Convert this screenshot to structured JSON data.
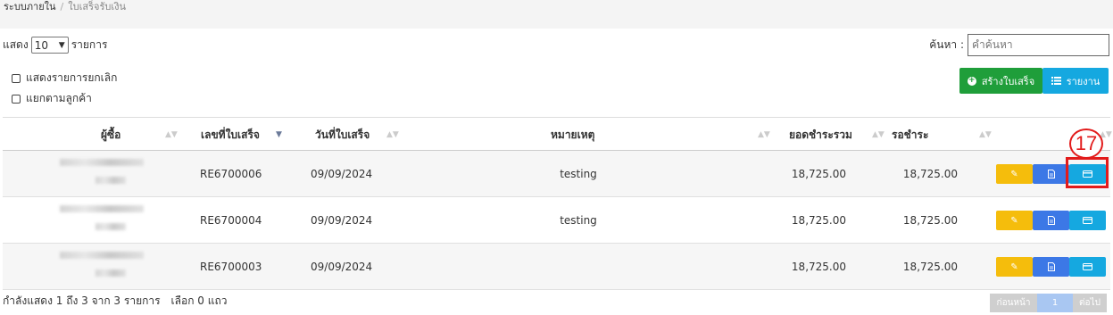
{
  "breadcrumb": {
    "root": "ระบบภายใน",
    "separator": "/",
    "current": "ใบเสร็จรับเงิน"
  },
  "length": {
    "prefix": "แสดง",
    "value": "10",
    "suffix": "รายการ"
  },
  "search": {
    "label": "ค้นหา :",
    "placeholder": "คำค้นหา"
  },
  "options": {
    "show_cancelled": "แสดงรายการยกเลิก",
    "group_by_customer": "แยกตามลูกค้า"
  },
  "toolbar": {
    "create_label": "สร้างใบเสร็จ",
    "report_label": "รายงาน"
  },
  "table": {
    "headers": {
      "buyer": "ผู้ซื้อ",
      "receipt_no": "เลขที่ใบเสร็จ",
      "date": "วันที่ใบเสร็จ",
      "note": "หมายเหตุ",
      "total": "ยอดชำระรวม",
      "pending": "รอชำระ"
    },
    "rows": [
      {
        "receipt_no": "RE6700006",
        "date": "09/09/2024",
        "note": "testing",
        "total": "18,725.00",
        "pending": "18,725.00"
      },
      {
        "receipt_no": "RE6700004",
        "date": "09/09/2024",
        "note": "testing",
        "total": "18,725.00",
        "pending": "18,725.00"
      },
      {
        "receipt_no": "RE6700003",
        "date": "09/09/2024",
        "note": "",
        "total": "18,725.00",
        "pending": "18,725.00"
      }
    ]
  },
  "annotation": {
    "step": "17"
  },
  "footer": {
    "info": "กำลังแสดง 1 ถึง 3 จาก 3 รายการ",
    "selected": "เลือก 0 แถว"
  },
  "pagination": {
    "prev": "ก่อนหน้า",
    "page": "1",
    "next": "ต่อไป"
  },
  "colors": {
    "create": "#1f9e3a",
    "report": "#15a8e0",
    "edit": "#f5bd0c",
    "doc": "#3c78e6",
    "pay": "#15a8e0",
    "annotation": "#e21b1b"
  },
  "icons": {
    "create": "plus-circle-icon",
    "report": "list-icon",
    "edit": "edit-icon",
    "doc": "document-icon",
    "pay": "credit-card-icon"
  }
}
